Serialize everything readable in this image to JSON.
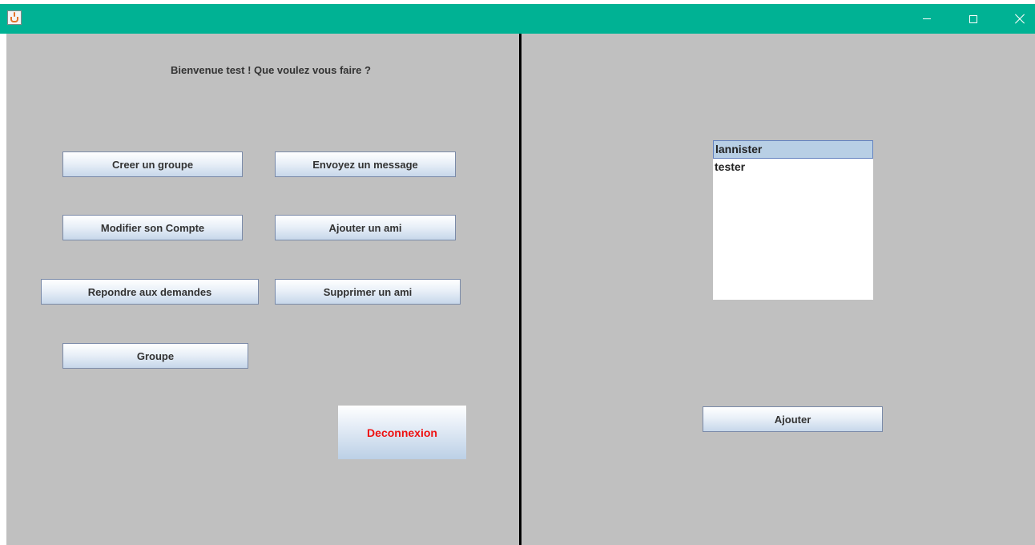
{
  "window": {
    "icon": "java-coffee-icon",
    "controls": {
      "minimize": "minimize-icon",
      "maximize": "maximize-icon",
      "close": "close-icon"
    }
  },
  "left": {
    "welcome": "Bienvenue test ! Que voulez vous faire ?",
    "buttons": {
      "create_group": "Creer un groupe",
      "send_message": "Envoyez un message",
      "modify_account": "Modifier son Compte",
      "add_friend": "Ajouter un ami",
      "answer_requests": "Repondre aux demandes",
      "remove_friend": "Supprimer un ami",
      "group": "Groupe",
      "logout": "Deconnexion"
    }
  },
  "right": {
    "list": [
      "lannister",
      "tester"
    ],
    "selected_index": 0,
    "add_button": "Ajouter"
  },
  "colors": {
    "titlebar": "#00b294",
    "panel": "#c0c0c0",
    "logout_text": "#ee1111",
    "selection": "#b8cfe5"
  }
}
